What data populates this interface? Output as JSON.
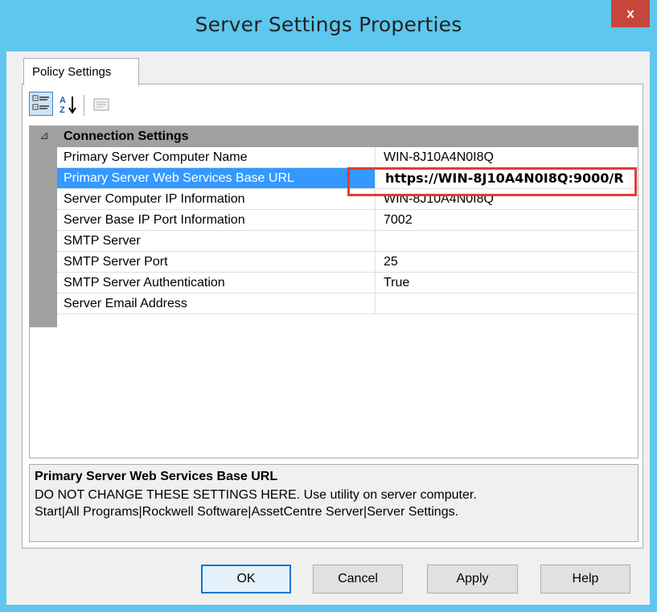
{
  "window": {
    "title": "Server Settings Properties",
    "close_glyph": "x"
  },
  "tabs": [
    {
      "label": "Policy Settings"
    }
  ],
  "toolbar": {
    "categorized_icon": "categorized-view-icon",
    "alphabetical_icon": "sort-alphabetical-icon",
    "property_pages_icon": "property-pages-icon"
  },
  "grid": {
    "category": {
      "label": "Connection Settings",
      "expander": "⊿"
    },
    "rows": [
      {
        "name": "Primary Server Computer Name",
        "value": "WIN-8J10A4N0I8Q"
      },
      {
        "name": "Primary Server Web Services Base URL",
        "value": "https://WIN-8J10A4N0I8Q:9000/R",
        "selected": true
      },
      {
        "name": "Server Computer IP Information",
        "value": "WIN-8J10A4N0I8Q"
      },
      {
        "name": "Server Base IP Port Information",
        "value": "7002"
      },
      {
        "name": "SMTP Server",
        "value": ""
      },
      {
        "name": "SMTP Server Port",
        "value": "25"
      },
      {
        "name": "SMTP Server Authentication",
        "value": "True"
      },
      {
        "name": "Server Email Address",
        "value": ""
      }
    ]
  },
  "description": {
    "title": "Primary Server Web Services Base URL",
    "line1": "DO NOT CHANGE THESE SETTINGS HERE. Use utility on server computer.",
    "line2": "Start|All Programs|Rockwell Software|AssetCentre Server|Server Settings."
  },
  "buttons": {
    "ok": "OK",
    "cancel": "Cancel",
    "apply": "Apply",
    "help": "Help"
  },
  "colors": {
    "titlebar": "#5ec7ee",
    "close": "#c7463b",
    "selection": "#3399ff",
    "highlight": "#e23a3a"
  }
}
